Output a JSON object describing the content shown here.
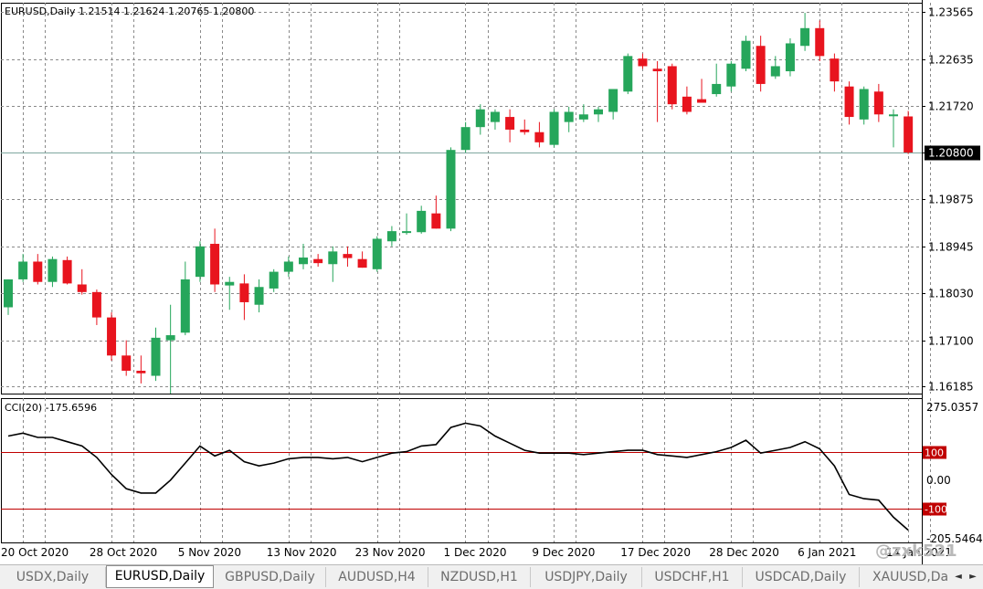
{
  "chart_data": [
    {
      "type": "candlestick",
      "title": "EURUSD,Daily  1.21514 1.21624 1.20765 1.20800",
      "symbol": "EURUSD",
      "timeframe": "Daily",
      "ohlc_header": {
        "open": "1.21514",
        "high": "1.21624",
        "low": "1.20765",
        "close": "1.20800"
      },
      "current_price_label": "1.20800",
      "current_price": 1.208,
      "ylim": [
        1.1605,
        1.2375
      ],
      "y_ticks": [
        "1.23565",
        "1.22635",
        "1.21720",
        "1.20800",
        "1.19875",
        "1.18945",
        "1.18030",
        "1.17100",
        "1.16185"
      ],
      "x_labels": [
        "20 Oct 2020",
        "28 Oct 2020",
        "5 Nov 2020",
        "13 Nov 2020",
        "23 Nov 2020",
        "1 Dec 2020",
        "9 Dec 2020",
        "17 Dec 2020",
        "28 Dec 2020",
        "6 Jan 2021",
        "14 Jan 2021"
      ],
      "x_label_bars": [
        0,
        6,
        12,
        18,
        24,
        30,
        36,
        42,
        48,
        54,
        60
      ],
      "grid": true,
      "up_color": "#26a65b",
      "down_color": "#e8141e",
      "candles": [
        {
          "o": 1.1775,
          "h": 1.181,
          "l": 1.176,
          "c": 1.183
        },
        {
          "o": 1.183,
          "h": 1.188,
          "l": 1.1825,
          "c": 1.1865
        },
        {
          "o": 1.1865,
          "h": 1.188,
          "l": 1.182,
          "c": 1.1825
        },
        {
          "o": 1.1825,
          "h": 1.1875,
          "l": 1.1815,
          "c": 1.187
        },
        {
          "o": 1.1868,
          "h": 1.1875,
          "l": 1.182,
          "c": 1.1822
        },
        {
          "o": 1.182,
          "h": 1.185,
          "l": 1.18,
          "c": 1.1805
        },
        {
          "o": 1.1805,
          "h": 1.181,
          "l": 1.174,
          "c": 1.1755
        },
        {
          "o": 1.1755,
          "h": 1.1765,
          "l": 1.167,
          "c": 1.168
        },
        {
          "o": 1.168,
          "h": 1.171,
          "l": 1.164,
          "c": 1.165
        },
        {
          "o": 1.165,
          "h": 1.168,
          "l": 1.1625,
          "c": 1.1645
        },
        {
          "o": 1.164,
          "h": 1.1735,
          "l": 1.163,
          "c": 1.1715
        },
        {
          "o": 1.171,
          "h": 1.178,
          "l": 1.1605,
          "c": 1.172
        },
        {
          "o": 1.1725,
          "h": 1.1865,
          "l": 1.172,
          "c": 1.183
        },
        {
          "o": 1.1835,
          "h": 1.1905,
          "l": 1.1825,
          "c": 1.1895
        },
        {
          "o": 1.19,
          "h": 1.193,
          "l": 1.1805,
          "c": 1.182
        },
        {
          "o": 1.1818,
          "h": 1.1835,
          "l": 1.177,
          "c": 1.1825
        },
        {
          "o": 1.1822,
          "h": 1.184,
          "l": 1.175,
          "c": 1.1785
        },
        {
          "o": 1.178,
          "h": 1.183,
          "l": 1.1765,
          "c": 1.1815
        },
        {
          "o": 1.1812,
          "h": 1.185,
          "l": 1.1805,
          "c": 1.1845
        },
        {
          "o": 1.1845,
          "h": 1.1875,
          "l": 1.1835,
          "c": 1.1865
        },
        {
          "o": 1.186,
          "h": 1.19,
          "l": 1.185,
          "c": 1.1873
        },
        {
          "o": 1.187,
          "h": 1.188,
          "l": 1.1855,
          "c": 1.1862
        },
        {
          "o": 1.186,
          "h": 1.1895,
          "l": 1.1825,
          "c": 1.1885
        },
        {
          "o": 1.188,
          "h": 1.1895,
          "l": 1.1855,
          "c": 1.1872
        },
        {
          "o": 1.187,
          "h": 1.1885,
          "l": 1.1855,
          "c": 1.1853
        },
        {
          "o": 1.185,
          "h": 1.1915,
          "l": 1.1845,
          "c": 1.191
        },
        {
          "o": 1.1905,
          "h": 1.1935,
          "l": 1.1895,
          "c": 1.1925
        },
        {
          "o": 1.1922,
          "h": 1.196,
          "l": 1.1918,
          "c": 1.1925
        },
        {
          "o": 1.1923,
          "h": 1.1975,
          "l": 1.192,
          "c": 1.1965
        },
        {
          "o": 1.196,
          "h": 1.1995,
          "l": 1.195,
          "c": 1.193
        },
        {
          "o": 1.193,
          "h": 1.209,
          "l": 1.1925,
          "c": 1.2085
        },
        {
          "o": 1.2085,
          "h": 1.214,
          "l": 1.208,
          "c": 1.213
        },
        {
          "o": 1.213,
          "h": 1.2175,
          "l": 1.2115,
          "c": 1.2165
        },
        {
          "o": 1.214,
          "h": 1.2165,
          "l": 1.2125,
          "c": 1.216
        },
        {
          "o": 1.215,
          "h": 1.2165,
          "l": 1.21,
          "c": 1.2125
        },
        {
          "o": 1.2125,
          "h": 1.2145,
          "l": 1.2115,
          "c": 1.212
        },
        {
          "o": 1.212,
          "h": 1.214,
          "l": 1.209,
          "c": 1.21
        },
        {
          "o": 1.2095,
          "h": 1.2165,
          "l": 1.209,
          "c": 1.216
        },
        {
          "o": 1.214,
          "h": 1.217,
          "l": 1.212,
          "c": 1.216
        },
        {
          "o": 1.2145,
          "h": 1.2175,
          "l": 1.214,
          "c": 1.2155
        },
        {
          "o": 1.2155,
          "h": 1.217,
          "l": 1.214,
          "c": 1.2165
        },
        {
          "o": 1.216,
          "h": 1.22,
          "l": 1.2145,
          "c": 1.2205
        },
        {
          "o": 1.22,
          "h": 1.2275,
          "l": 1.2195,
          "c": 1.227
        },
        {
          "o": 1.2265,
          "h": 1.2275,
          "l": 1.2245,
          "c": 1.225
        },
        {
          "o": 1.2245,
          "h": 1.226,
          "l": 1.214,
          "c": 1.224
        },
        {
          "o": 1.225,
          "h": 1.2255,
          "l": 1.2165,
          "c": 1.2175
        },
        {
          "o": 1.219,
          "h": 1.221,
          "l": 1.2155,
          "c": 1.216
        },
        {
          "o": 1.2185,
          "h": 1.2225,
          "l": 1.218,
          "c": 1.2178
        },
        {
          "o": 1.2195,
          "h": 1.2255,
          "l": 1.219,
          "c": 1.2215
        },
        {
          "o": 1.221,
          "h": 1.226,
          "l": 1.22,
          "c": 1.2255
        },
        {
          "o": 1.2245,
          "h": 1.231,
          "l": 1.224,
          "c": 1.23
        },
        {
          "o": 1.229,
          "h": 1.231,
          "l": 1.22,
          "c": 1.2215
        },
        {
          "o": 1.223,
          "h": 1.227,
          "l": 1.2225,
          "c": 1.225
        },
        {
          "o": 1.224,
          "h": 1.2305,
          "l": 1.223,
          "c": 1.2295
        },
        {
          "o": 1.229,
          "h": 1.2355,
          "l": 1.228,
          "c": 1.2325
        },
        {
          "o": 1.2325,
          "h": 1.234,
          "l": 1.226,
          "c": 1.227
        },
        {
          "o": 1.2265,
          "h": 1.2275,
          "l": 1.22,
          "c": 1.222
        },
        {
          "o": 1.221,
          "h": 1.222,
          "l": 1.2135,
          "c": 1.215
        },
        {
          "o": 1.2145,
          "h": 1.221,
          "l": 1.2135,
          "c": 1.2205
        },
        {
          "o": 1.22,
          "h": 1.2215,
          "l": 1.214,
          "c": 1.2155
        },
        {
          "o": 1.2155,
          "h": 1.2165,
          "l": 1.209,
          "c": 1.2155
        },
        {
          "o": 1.2151,
          "h": 1.2162,
          "l": 1.2077,
          "c": 1.208
        }
      ]
    },
    {
      "type": "line",
      "title": "CCI(20) -175.6596",
      "indicator": "CCI(20)",
      "last_value": "-175.6596",
      "ylim": [
        -205.5464,
        275.0357
      ],
      "y_tick_labels": [
        "275.0357",
        "0.00",
        "-205.5464"
      ],
      "levels": [
        100,
        -100
      ],
      "level_labels": [
        "100",
        "-100"
      ],
      "level_color": "#c00000",
      "line_color": "#000000",
      "values": [
        155,
        165,
        150,
        150,
        135,
        120,
        80,
        20,
        -30,
        -45,
        -45,
        0,
        60,
        120,
        85,
        105,
        65,
        50,
        60,
        75,
        80,
        80,
        75,
        80,
        65,
        80,
        95,
        100,
        120,
        125,
        185,
        200,
        190,
        155,
        130,
        105,
        95,
        95,
        95,
        90,
        95,
        100,
        105,
        105,
        90,
        85,
        80,
        90,
        100,
        115,
        140,
        95,
        105,
        115,
        135,
        110,
        50,
        -50,
        -65,
        -70,
        -130,
        -175
      ]
    }
  ],
  "watermark": "@zxk521",
  "bottom_tabs": [
    "USDX,Daily",
    "EURUSD,Daily",
    "GBPUSD,Daily",
    "AUDUSD,H4",
    "NZDUSD,H1",
    "USDJPY,Daily",
    "USDCHF,H1",
    "USDCAD,Daily",
    "XAUUSD,Da"
  ],
  "active_tab_index": 1,
  "nav_left_icon": "◄",
  "nav_right_icon": "►"
}
